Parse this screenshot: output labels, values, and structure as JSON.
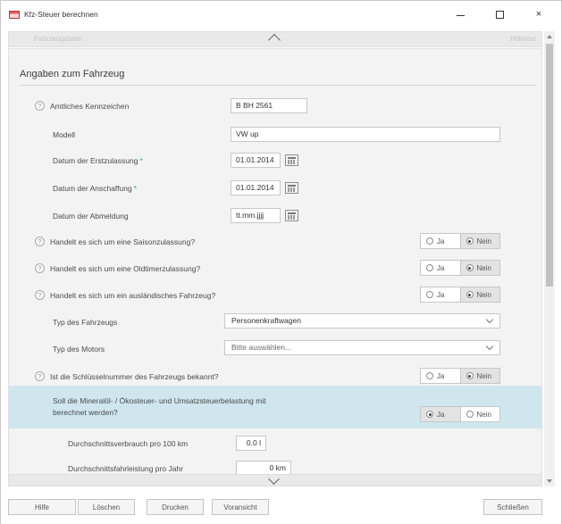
{
  "window": {
    "title": "Kfz-Steuer berechnen",
    "close_glyph": "×"
  },
  "top_strip": {
    "left_text": "Fahrzeugdaten",
    "right_text": "Hilfetext"
  },
  "section": {
    "title": "Angaben zum Fahrzeug"
  },
  "fields": {
    "kennzeichen_label": "Amtliches Kennzeichen",
    "kennzeichen_value": "B BH 2561",
    "modell_label": "Modell",
    "modell_value": "VW up",
    "erstzulassung_label": "Datum der Erstzulassung",
    "erstzulassung_value": "01.01.2014",
    "anschaffung_label": "Datum der Anschaffung",
    "anschaffung_value": "01.01.2014",
    "abmeldung_label": "Datum der Abmeldung",
    "abmeldung_value": "tt.mm.jjjj",
    "required_mark": "*"
  },
  "questions": {
    "saison": "Handelt es sich um eine Saisonzulassung?",
    "oldtimer": "Handelt es sich um eine Oldtimerzulassung?",
    "ausland": "Handelt es sich um ein ausländisches Fahrzeug?",
    "schluessel": "Ist die Schlüsselnummer des Fahrzeugs bekannt?",
    "mineraloel_line1": "Soll die Mineralöl- / Ökosteuer- und Umsatzsteuerbelastung mit",
    "mineraloel_line2": "berechnet werden?"
  },
  "radio": {
    "yes": "Ja",
    "no": "Nein"
  },
  "selects": {
    "typ_fahrzeug_label": "Typ des Fahrzeugs",
    "typ_fahrzeug_value": "Personenkraftwagen",
    "typ_motor_label": "Typ des Motors",
    "typ_motor_value": "Bitte auswählen..."
  },
  "consumption": {
    "verbrauch_label": "Durchschnittsverbrauch pro 100 km",
    "verbrauch_value": "0.0 l",
    "fahrleistung_label": "Durchschnittsfahrleistung pro Jahr",
    "fahrleistung_value": "0 km"
  },
  "footer": {
    "hilfe": "Hilfe",
    "loeschen": "Löschen",
    "drucken": "Drucken",
    "vorschau": "Voransicht",
    "schliessen": "Schließen"
  }
}
